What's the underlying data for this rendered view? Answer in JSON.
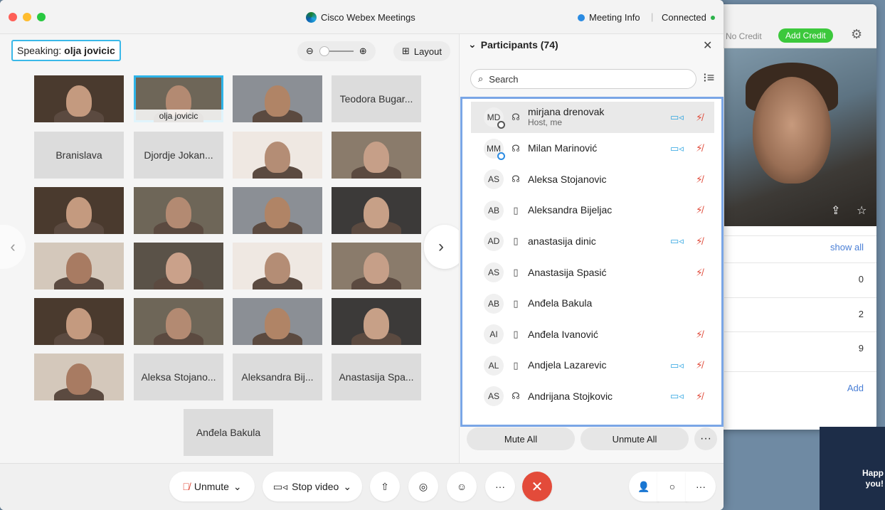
{
  "background_window": {
    "no_credit": "No Credit",
    "add_credit": "Add Credit",
    "show_all": "show all",
    "rows": [
      "0",
      "2",
      "9"
    ],
    "add": "Add",
    "ext_text": "Happ\nyou!"
  },
  "titlebar": {
    "title": "Cisco Webex Meetings",
    "meeting_info": "Meeting Info",
    "separator": "|",
    "status": "Connected"
  },
  "stage": {
    "speaking_label": "Speaking:",
    "speaking_name": "olja jovicic",
    "zoom_out": "⊖",
    "zoom_in": "⊕",
    "layout_label": "Layout",
    "tiles": [
      {
        "type": "video",
        "label": ""
      },
      {
        "type": "video",
        "label": "olja jovicic",
        "selected": true
      },
      {
        "type": "video",
        "label": ""
      },
      {
        "type": "name",
        "label": "Teodora Bugar..."
      },
      {
        "type": "name",
        "label": "Branislava"
      },
      {
        "type": "name",
        "label": "Djordje Jokan..."
      },
      {
        "type": "video",
        "label": ""
      },
      {
        "type": "video",
        "label": ""
      },
      {
        "type": "video",
        "label": ""
      },
      {
        "type": "video",
        "label": ""
      },
      {
        "type": "video",
        "label": ""
      },
      {
        "type": "video",
        "label": ""
      },
      {
        "type": "video",
        "label": ""
      },
      {
        "type": "video",
        "label": ""
      },
      {
        "type": "video",
        "label": ""
      },
      {
        "type": "video",
        "label": ""
      },
      {
        "type": "video",
        "label": ""
      },
      {
        "type": "video",
        "label": ""
      },
      {
        "type": "video",
        "label": ""
      },
      {
        "type": "video",
        "label": ""
      },
      {
        "type": "video",
        "label": ""
      },
      {
        "type": "name",
        "label": "Aleksa Stojano..."
      },
      {
        "type": "name",
        "label": "Aleksandra Bij..."
      },
      {
        "type": "name",
        "label": "Anastasija Spa..."
      },
      {
        "type": "name",
        "label": "Anđela Bakula"
      }
    ]
  },
  "participants": {
    "title": "Participants (74)",
    "search_placeholder": "Search",
    "list": [
      {
        "initials": "MD",
        "audio": "headset",
        "name": "mirjana drenovak",
        "sub": "Host, me",
        "video": true,
        "muted": true,
        "host": true
      },
      {
        "initials": "MM",
        "audio": "headset",
        "name": "Milan Marinović",
        "sub": "",
        "video": true,
        "muted": true
      },
      {
        "initials": "AS",
        "audio": "headset",
        "name": "Aleksa Stojanovic",
        "sub": "",
        "video": false,
        "muted": true
      },
      {
        "initials": "AB",
        "audio": "phone",
        "name": "Aleksandra Bijeljac",
        "sub": "",
        "video": false,
        "muted": true
      },
      {
        "initials": "AD",
        "audio": "phone",
        "name": "anastasija dinic",
        "sub": "",
        "video": true,
        "muted": true
      },
      {
        "initials": "AS",
        "audio": "phone",
        "name": "Anastasija Spasić",
        "sub": "",
        "video": false,
        "muted": true
      },
      {
        "initials": "AB",
        "audio": "phone",
        "name": "Anđela Bakula",
        "sub": "",
        "video": false,
        "muted": false
      },
      {
        "initials": "AI",
        "audio": "phone",
        "name": "Anđela Ivanović",
        "sub": "",
        "video": false,
        "muted": true
      },
      {
        "initials": "AL",
        "audio": "phone",
        "name": "Andjela Lazarevic",
        "sub": "",
        "video": true,
        "muted": true
      },
      {
        "initials": "AS",
        "audio": "headset",
        "name": "Andrijana Stojkovic",
        "sub": "",
        "video": true,
        "muted": true
      }
    ],
    "mute_all": "Mute All",
    "unmute_all": "Unmute All",
    "more": "···"
  },
  "controls": {
    "unmute": "Unmute",
    "stop_video": "Stop video",
    "more": "···"
  },
  "colors": {
    "accent": "#2eb4e8",
    "end": "#e34b3a",
    "mic_off": "#e04a3a"
  }
}
